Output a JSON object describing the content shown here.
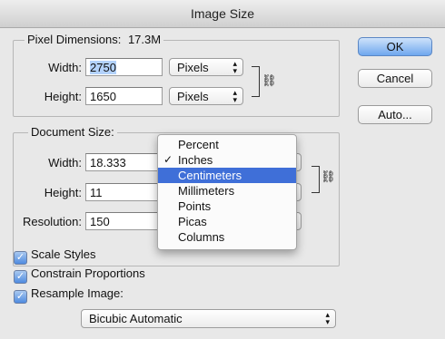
{
  "window": {
    "title": "Image Size"
  },
  "pixel_dimensions": {
    "legend": "Pixel Dimensions:",
    "size": "17.3M",
    "width_label": "Width:",
    "width_value": "2750",
    "width_unit": "Pixels",
    "height_label": "Height:",
    "height_value": "1650",
    "height_unit": "Pixels"
  },
  "document_size": {
    "legend": "Document Size:",
    "width_label": "Width:",
    "width_value": "18.333",
    "height_label": "Height:",
    "height_value": "11",
    "resolution_label": "Resolution:",
    "resolution_value": "150"
  },
  "buttons": {
    "ok": "OK",
    "cancel": "Cancel",
    "auto": "Auto..."
  },
  "checkboxes": [
    {
      "label": "Scale Styles",
      "checked": true
    },
    {
      "label": "Constrain Proportions",
      "checked": true
    },
    {
      "label": "Resample Image:",
      "checked": true
    }
  ],
  "resample_method": "Bicubic Automatic",
  "unit_menu": {
    "items": [
      "Percent",
      "Inches",
      "Centimeters",
      "Millimeters",
      "Points",
      "Picas",
      "Columns"
    ],
    "checked_item": "Inches",
    "highlighted_item": "Centimeters",
    "check_mark": "✓"
  },
  "icons": {
    "chain": "chain-link-icon",
    "check": "checkmark-icon",
    "updown": "up-down-arrows-icon"
  },
  "colors": {
    "highlight": "#3f6fd8",
    "primary_button": "#6fa7ee"
  }
}
